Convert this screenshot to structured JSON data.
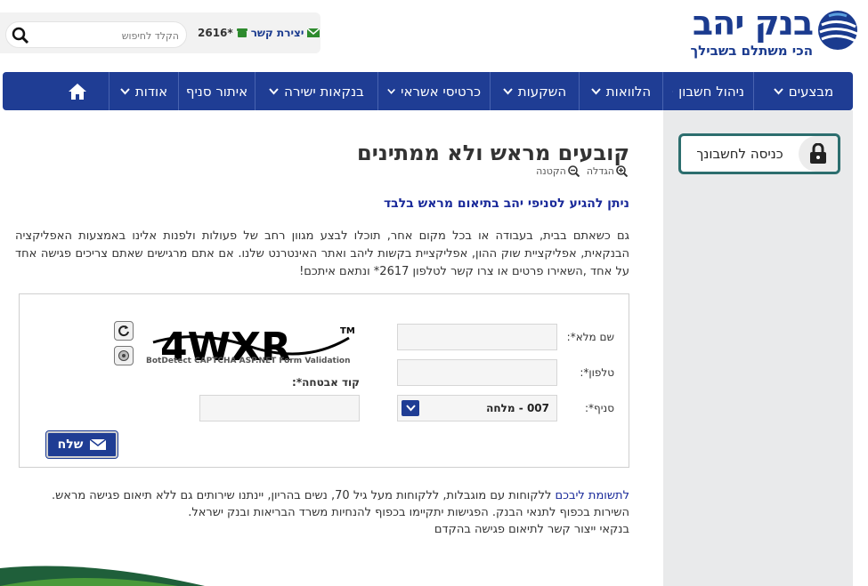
{
  "brand": {
    "name": "בנק יהב",
    "slogan": "הכי משתלם בשבילך"
  },
  "topbar": {
    "search_placeholder": "הקלד לחיפוש",
    "contact_label": "יצירת קשר",
    "contact_number": "*2616"
  },
  "nav": {
    "items": [
      {
        "label": "מבצעים"
      },
      {
        "label": "ניהול חשבון"
      },
      {
        "label": "הלוואות"
      },
      {
        "label": "השקעות"
      },
      {
        "label": "כרטיסי אשראי"
      },
      {
        "label": "בנקאות ישירה"
      },
      {
        "label": "איתור סניף"
      },
      {
        "label": "אודות"
      }
    ]
  },
  "sidebar": {
    "login_label": "כניסה לחשבונך"
  },
  "main": {
    "title": "קובעים מראש ולא ממתינים",
    "zoom_in": "הגדלה",
    "zoom_out": "הקטנה",
    "subtitle": "ניתן להגיע לסניפי יהב בתיאום מראש בלבד",
    "intro": "גם כשאתם בבית, בעבודה או בכל מקום אחר, תוכלו לבצע מגוון רחב של פעולות ולפנות אלינו באמצעות האפליקציה הבנקאית, אפליקציית שוק ההון, אפליקציית בקשות ליהב ואתר האינטרנט שלנו. אם אתם מרגישים שאתם צריכים פגישה אחד על אחד ,השאירו פרטים או צרו קשר לטלפון 2617* ונתאם איתכם!"
  },
  "form": {
    "fullname_label": "שם מלא*:",
    "phone_label": "טלפון*:",
    "branch_label": "סניף*:",
    "branch_value": "007 - מלחה",
    "captcha_text": "4WXR",
    "captcha_footer": "BotDetect CAPTCHA ASP.NET Form Validation",
    "captcha_label": "קוד אבטחה*:",
    "send_label": "שלח"
  },
  "notes": {
    "line1_highlight": "לתשומת ליבכם",
    "line1_rest": " ללקוחות עם מוגבלות, ללקוחות מעל גיל 70, נשים בהריון, יינתנו שירותים גם ללא תיאום פגישה מראש.",
    "line2": "השירות בכפוף לתנאי הבנק. הפגישות יתקיימו בכפוף להנחיות משרד הבריאות ובנק ישראל.",
    "line3": "בנקאי ייצור קשר לתיאום פגישה בהקדם"
  },
  "colors": {
    "brand_blue": "#1f3d94",
    "sidebar_bg": "#e9eaeb",
    "login_border": "#2c6e6e"
  }
}
